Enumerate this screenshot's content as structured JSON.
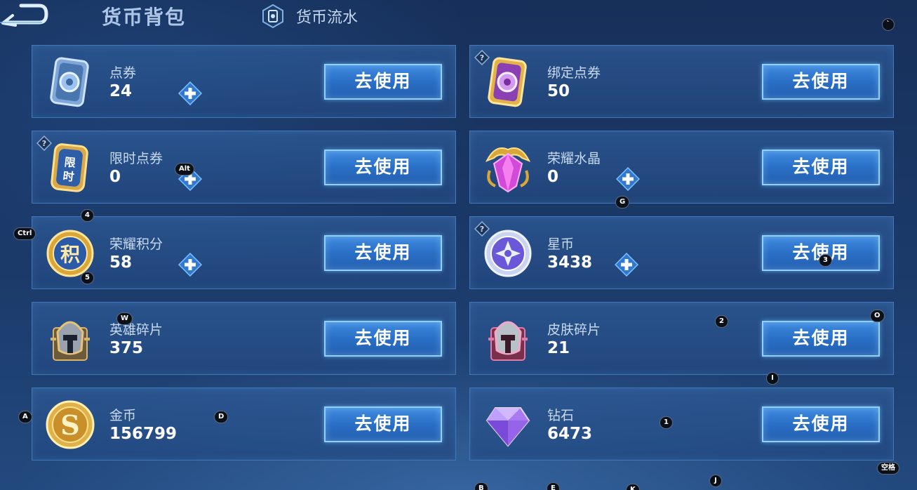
{
  "header": {
    "title": "货币背包",
    "history_tab_label": "货币流水"
  },
  "use_button_label": "去使用",
  "currencies": [
    {
      "name": "点券",
      "value": "24",
      "icon": "coupon-card-icon",
      "has_plus": true,
      "has_help": false
    },
    {
      "name": "绑定点券",
      "value": "50",
      "icon": "bound-coupon-card-icon",
      "has_plus": false,
      "has_help": true
    },
    {
      "name": "限时点券",
      "value": "0",
      "icon": "limited-coupon-icon",
      "has_plus": true,
      "has_help": true
    },
    {
      "name": "荣耀水晶",
      "value": "0",
      "icon": "glory-crystal-icon",
      "has_plus": true,
      "has_help": false
    },
    {
      "name": "荣耀积分",
      "value": "58",
      "icon": "glory-points-icon",
      "has_plus": true,
      "has_help": false
    },
    {
      "name": "星币",
      "value": "3438",
      "icon": "star-coin-icon",
      "has_plus": true,
      "has_help": true
    },
    {
      "name": "英雄碎片",
      "value": "375",
      "icon": "hero-fragment-icon",
      "has_plus": false,
      "has_help": false
    },
    {
      "name": "皮肤碎片",
      "value": "21",
      "icon": "skin-fragment-icon",
      "has_plus": false,
      "has_help": false
    },
    {
      "name": "金币",
      "value": "156799",
      "icon": "gold-coin-icon",
      "has_plus": false,
      "has_help": false
    },
    {
      "name": "钻石",
      "value": "6473",
      "icon": "diamond-icon",
      "has_plus": false,
      "has_help": false
    }
  ],
  "key_hints": [
    "`",
    "Alt",
    "4",
    "G",
    "Ctrl",
    "3",
    "5",
    "W",
    "2",
    "O",
    "I",
    "A",
    "D",
    "1",
    "空格",
    "J",
    "B",
    "E",
    "K"
  ],
  "colors": {
    "accent_button": "#2a6fc6",
    "button_border": "#8fd0ff",
    "card_border": "#3f77b8",
    "plus_color": "#2f7ad0"
  }
}
